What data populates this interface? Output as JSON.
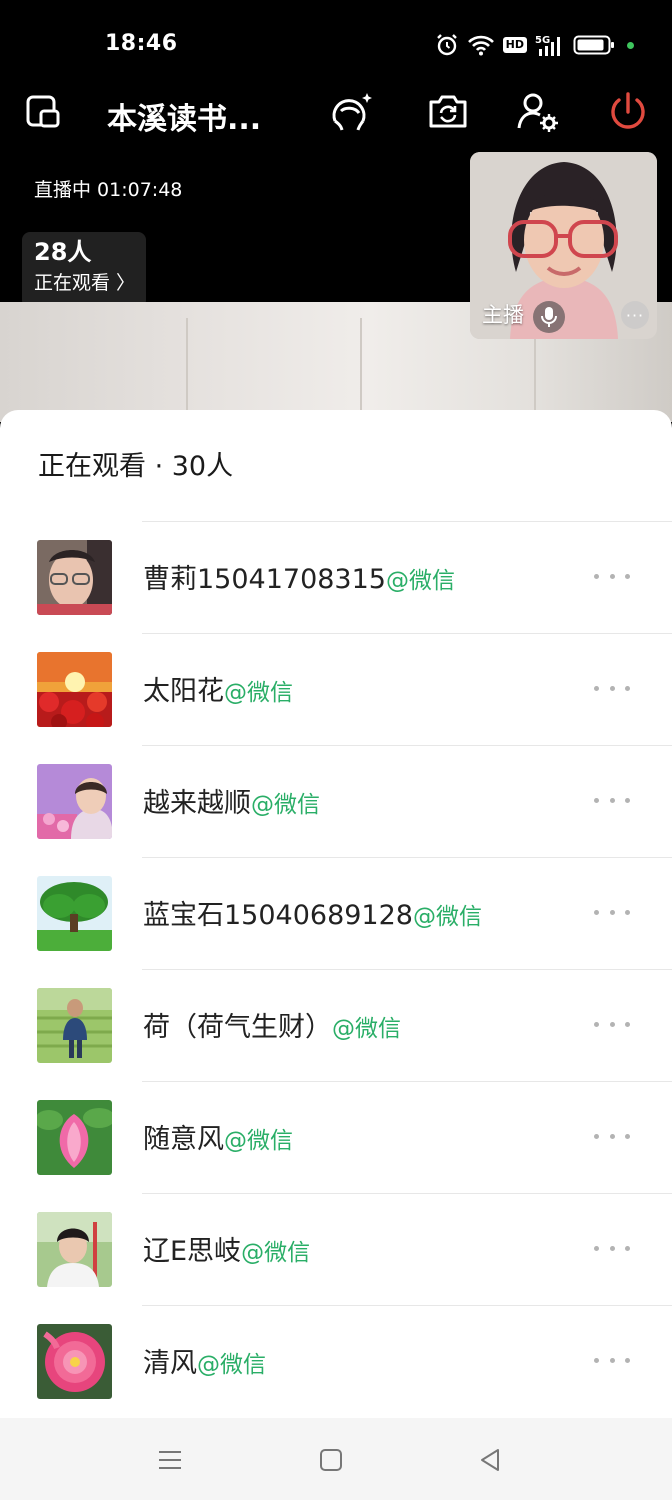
{
  "status_bar": {
    "time": "18:46",
    "hd": "HD"
  },
  "toolbar": {
    "room_title": "本溪读书..."
  },
  "live": {
    "status_text": "直播中 01:07:48",
    "viewer_count": "28人",
    "viewer_link": "正在观看 〉"
  },
  "host": {
    "label": "主播"
  },
  "sheet": {
    "title": "正在观看 · 30人",
    "source_tag": "@微信",
    "viewers": [
      {
        "name": "曹莉15041708315",
        "tag": "@微信",
        "avatar": "woman-with-glasses"
      },
      {
        "name": "太阳花",
        "tag": "@微信",
        "avatar": "sunset-red-flowers"
      },
      {
        "name": "越来越顺",
        "tag": "@微信",
        "avatar": "woman-purple-background"
      },
      {
        "name": "蓝宝石15040689128",
        "tag": "@微信",
        "avatar": "big-green-tree"
      },
      {
        "name": "荷（荷气生财）",
        "tag": "@微信",
        "avatar": "person-in-field"
      },
      {
        "name": "随意风",
        "tag": "@微信",
        "avatar": "pink-lotus"
      },
      {
        "name": "辽E思岐",
        "tag": "@微信",
        "avatar": "woman-outdoors"
      },
      {
        "name": "清风",
        "tag": "@微信",
        "avatar": "pink-peony"
      }
    ]
  },
  "colors": {
    "accent_green": "#2aae67",
    "power_red": "#e04a3f",
    "battery_dot": "#3ec55d"
  }
}
